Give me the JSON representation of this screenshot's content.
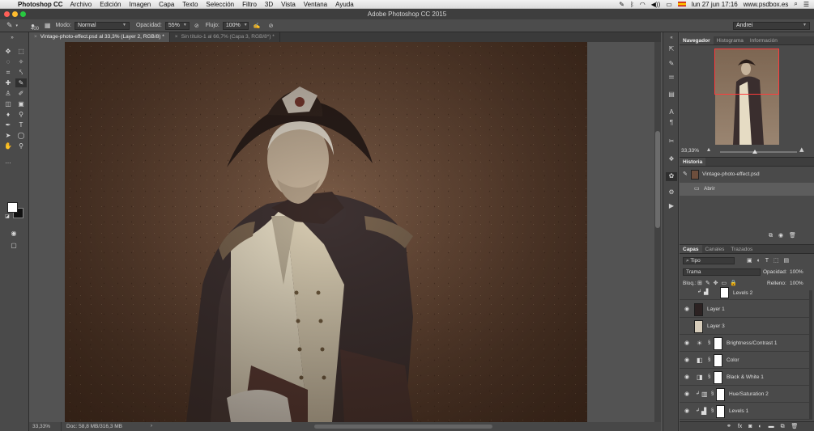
{
  "menubar": {
    "app_name": "Photoshop CC",
    "menus": [
      "Archivo",
      "Edición",
      "Imagen",
      "Capa",
      "Texto",
      "Selección",
      "Filtro",
      "3D",
      "Vista",
      "Ventana",
      "Ayuda"
    ],
    "clock": "lun 27 jun  17:16",
    "site": "www.psdbox.es"
  },
  "titlebar": {
    "title": "Adobe Photoshop CC 2015"
  },
  "options": {
    "brush_size": "400",
    "mode_label": "Modo:",
    "mode_value": "Normal",
    "opacity_label": "Opacidad:",
    "opacity_value": "55%",
    "flow_label": "Flujo:",
    "flow_value": "100%",
    "workspace": "Andrei"
  },
  "tabs": [
    {
      "label": "Vintage-photo-effect.psd al 33,3% (Layer 2, RGB/8) *"
    },
    {
      "label": "Sin título-1 al 66,7% (Capa 3, RGB/8*) *"
    }
  ],
  "status": {
    "zoom": "33,33%",
    "doc": "Doc: 58,8 MB/316,3 MB"
  },
  "navigator": {
    "tabs": [
      "Navegador",
      "Histograma",
      "Información"
    ],
    "zoom": "33,33%"
  },
  "history": {
    "tab": "Historia",
    "rows": [
      {
        "label": "Vintage-photo-effect.psd"
      },
      {
        "label": "Abrir"
      }
    ]
  },
  "layers": {
    "tabs": [
      "Capas",
      "Canales",
      "Trazados"
    ],
    "filter": "Tipo",
    "blend": "Trama",
    "opacity_label": "Opacidad:",
    "opacity_value": "100%",
    "lock_label": "Bloq.:",
    "fill_label": "Relleno:",
    "fill_value": "100%",
    "rows": [
      {
        "name": "Levels 2"
      },
      {
        "name": "Layer 1"
      },
      {
        "name": "Layer 3"
      },
      {
        "name": "Brightness/Contrast 1"
      },
      {
        "name": "Color"
      },
      {
        "name": "Black & White 1"
      },
      {
        "name": "Hue/Saturation 2"
      },
      {
        "name": "Levels 1"
      }
    ]
  }
}
